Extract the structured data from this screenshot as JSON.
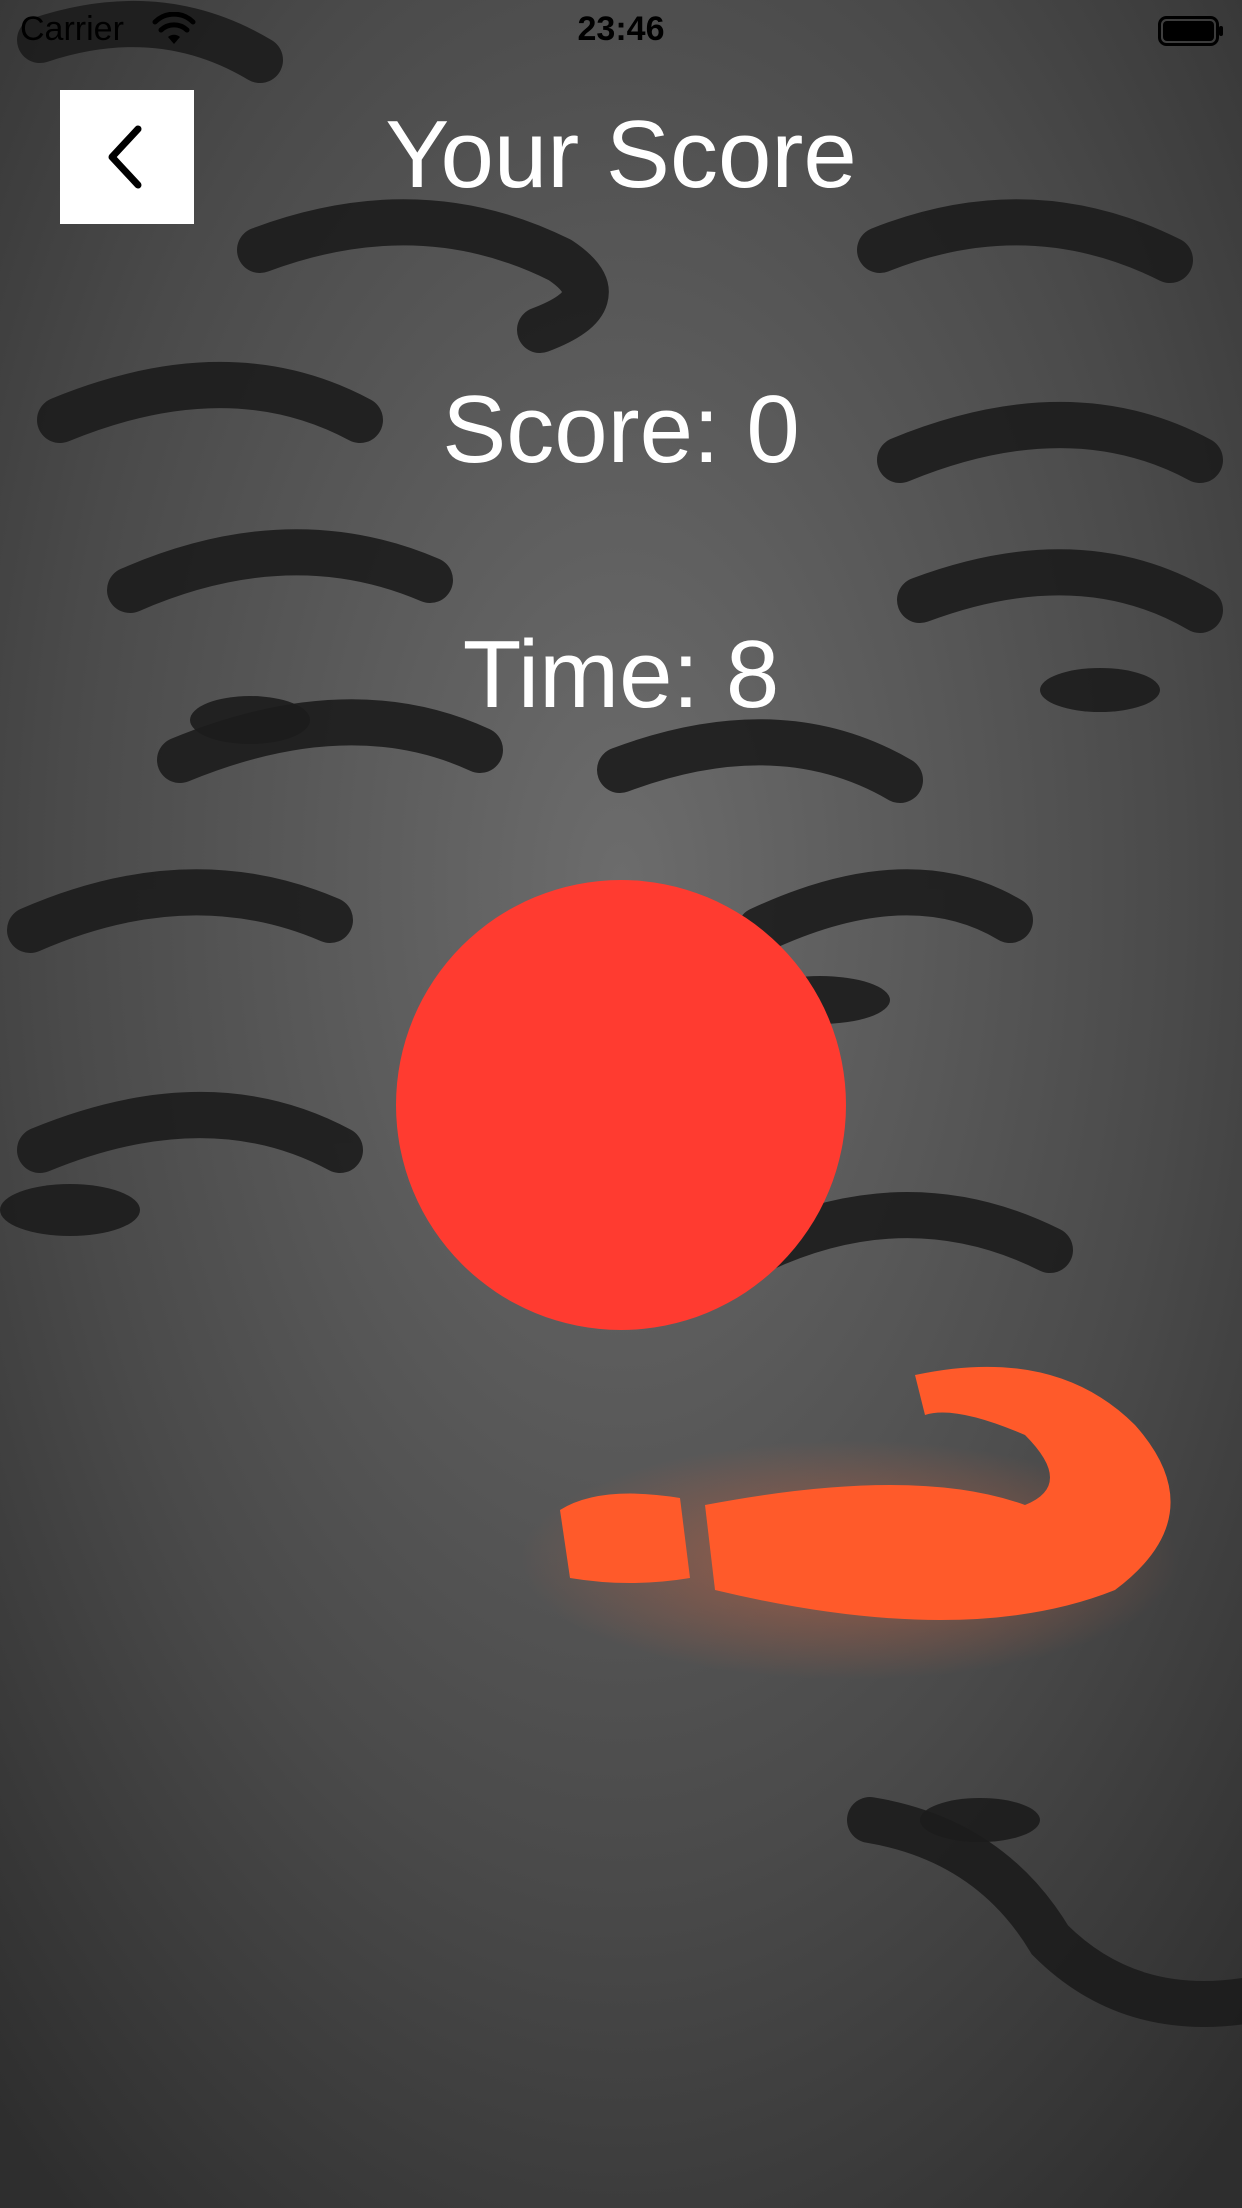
{
  "status_bar": {
    "carrier": "Carrier",
    "time": "23:46"
  },
  "header": {
    "title": "Your Score",
    "back_icon": "chevron-left-icon"
  },
  "game": {
    "score_text": "Score: 0",
    "time_text": "Time: 8",
    "target_color": "#ff3b30"
  },
  "background": {
    "description_icon": "question-marks-background",
    "accent_color": "#ff5a2a"
  }
}
